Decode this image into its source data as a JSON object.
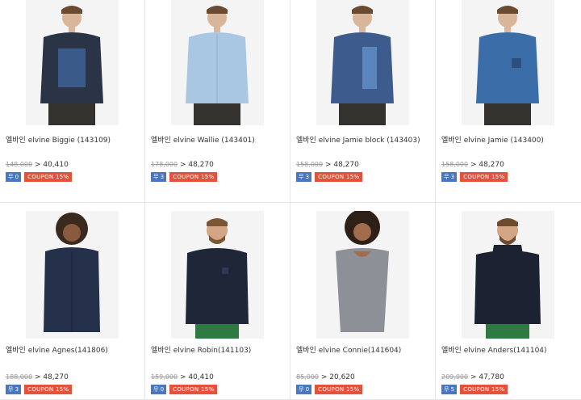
{
  "products": [
    {
      "title": "엘바인 elvine Biggie (143109)",
      "old_price": "148,000",
      "price": "40,410",
      "ship": "무 0",
      "coupon": "COUPON 15%",
      "shirt_color": "#2b3346",
      "accent": "E"
    },
    {
      "title": "엘바인 elvine Wallie (143401)",
      "old_price": "178,000",
      "price": "48,270",
      "ship": "무 3",
      "coupon": "COUPON 15%",
      "shirt_color": "#a9c7e2",
      "accent": ""
    },
    {
      "title": "엘바인 elvine Jamie block (143403)",
      "old_price": "158,000",
      "price": "48,270",
      "ship": "무 3",
      "coupon": "COUPON 15%",
      "shirt_color": "#3d5b8c",
      "accent": "block"
    },
    {
      "title": "엘바인 elvine Jamie (143400)",
      "old_price": "158,000",
      "price": "48,270",
      "ship": "무 3",
      "coupon": "COUPON 15%",
      "shirt_color": "#3b6ea8",
      "accent": ""
    },
    {
      "title": "엘바인 elvine Agnes(141806)",
      "old_price": "188,000",
      "price": "48,270",
      "ship": "무 3",
      "coupon": "COUPON 15%",
      "shirt_color": "#25304a",
      "accent": ""
    },
    {
      "title": "엘바인 elvine Robin(141103)",
      "old_price": "159,000",
      "price": "40,410",
      "ship": "무 0",
      "coupon": "COUPON 15%",
      "shirt_color": "#1f2638",
      "accent": ""
    },
    {
      "title": "엘바인 elvine Connie(141604)",
      "old_price": "85,000",
      "price": "20,620",
      "ship": "무 0",
      "coupon": "COUPON 15%",
      "shirt_color": "#8d9096",
      "accent": ""
    },
    {
      "title": "엘바인 elvine Anders(141104)",
      "old_price": "209,000",
      "price": "47,780",
      "ship": "무 5",
      "coupon": "COUPON 15%",
      "shirt_color": "#1c2232",
      "accent": ""
    }
  ]
}
